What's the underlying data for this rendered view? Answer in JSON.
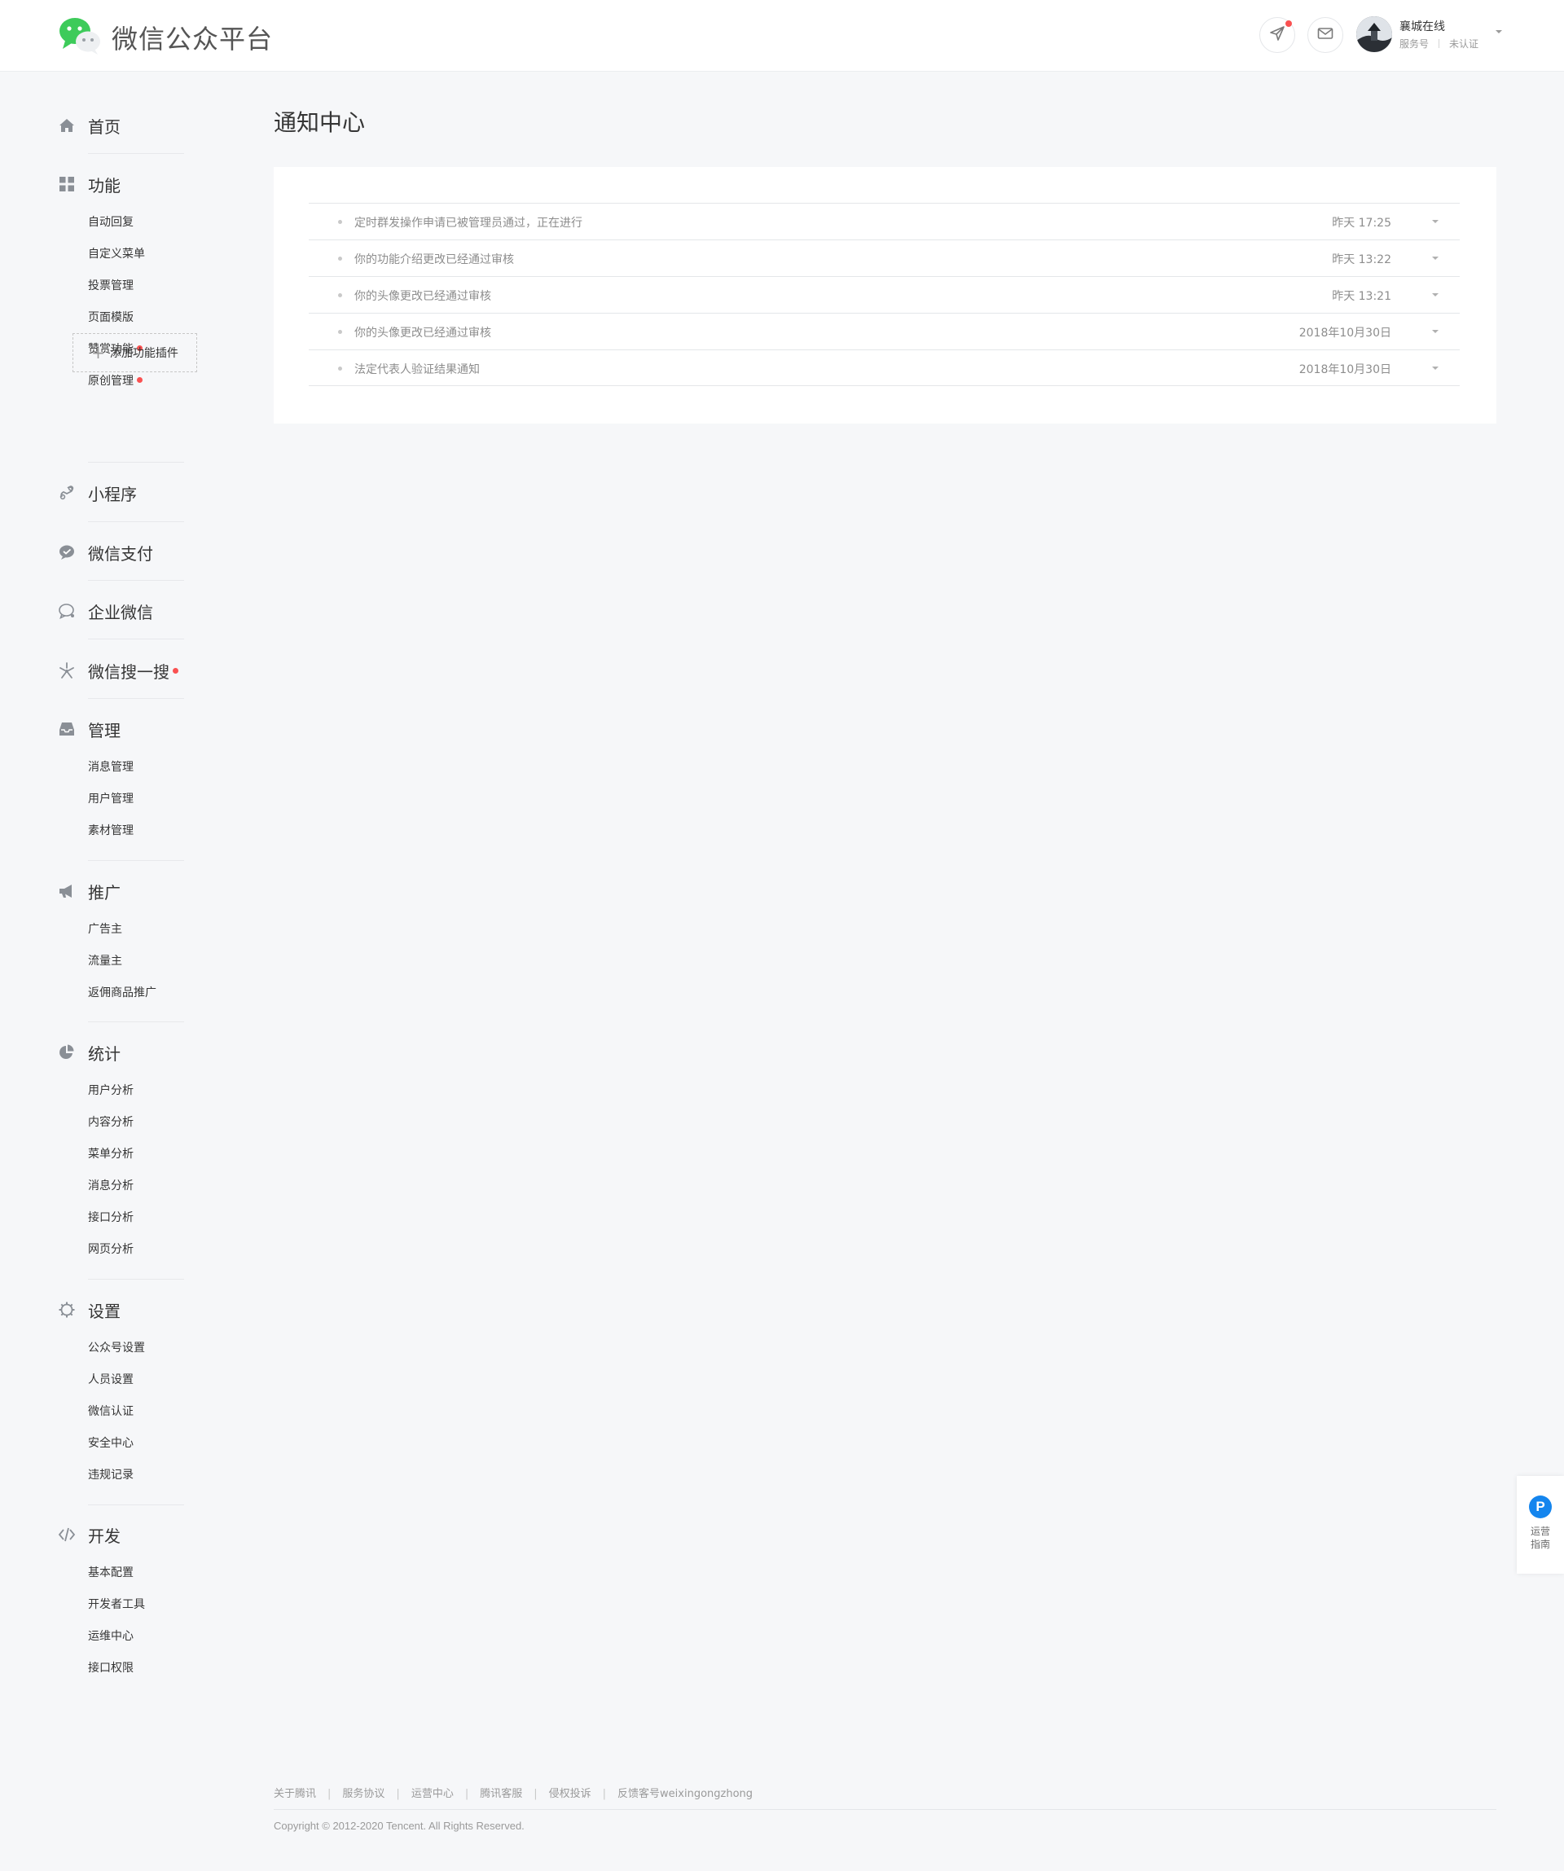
{
  "header": {
    "brand": "微信公众平台",
    "account": {
      "name": "襄城在线",
      "type": "服务号",
      "verify": "未认证"
    }
  },
  "sidebar": {
    "home": "首页",
    "function": {
      "label": "功能",
      "items": [
        "自动回复",
        "自定义菜单",
        "投票管理",
        "页面模版",
        "赞赏功能",
        "原创管理"
      ],
      "add_plugin": "添加功能插件"
    },
    "miniprogram": "小程序",
    "wxpay": "微信支付",
    "work_wechat": "企业微信",
    "search": "微信搜一搜",
    "manage": {
      "label": "管理",
      "items": [
        "消息管理",
        "用户管理",
        "素材管理"
      ]
    },
    "promote": {
      "label": "推广",
      "items": [
        "广告主",
        "流量主",
        "返佣商品推广"
      ]
    },
    "stats": {
      "label": "统计",
      "items": [
        "用户分析",
        "内容分析",
        "菜单分析",
        "消息分析",
        "接口分析",
        "网页分析"
      ]
    },
    "settings": {
      "label": "设置",
      "items": [
        "公众号设置",
        "人员设置",
        "微信认证",
        "安全中心",
        "违规记录"
      ]
    },
    "dev": {
      "label": "开发",
      "items": [
        "基本配置",
        "开发者工具",
        "运维中心",
        "接口权限"
      ]
    }
  },
  "main": {
    "title": "通知中心",
    "notifications": [
      {
        "text": "定时群发操作申请已被管理员通过，正在进行",
        "time": "昨天 17:25"
      },
      {
        "text": "你的功能介绍更改已经通过审核",
        "time": "昨天 13:22"
      },
      {
        "text": "你的头像更改已经通过审核",
        "time": "昨天 13:21"
      },
      {
        "text": "你的头像更改已经通过审核",
        "time": "2018年10月30日"
      },
      {
        "text": "法定代表人验证结果通知",
        "time": "2018年10月30日"
      }
    ]
  },
  "guide": {
    "icon_letter": "P",
    "label": "运营指南"
  },
  "footer": {
    "links": [
      "关于腾讯",
      "服务协议",
      "运营中心",
      "腾讯客服",
      "侵权投诉",
      "反馈客号weixingongzhong"
    ],
    "copyright": "Copyright © 2012-2020 Tencent. All Rights Reserved."
  },
  "colors": {
    "accent_red": "#fa5151",
    "brand_green": "#3dcb5a",
    "guide_blue": "#1485ee",
    "background": "#f6f7f9"
  }
}
